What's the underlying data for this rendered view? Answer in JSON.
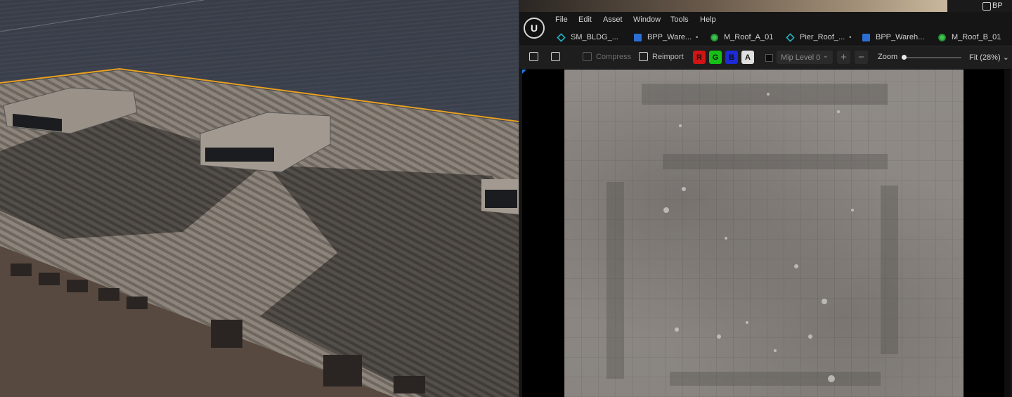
{
  "topbar": {
    "right_label": "BP"
  },
  "menu": [
    "File",
    "Edit",
    "Asset",
    "Window",
    "Tools",
    "Help"
  ],
  "tabs": [
    {
      "label": "SM_BLDG_...",
      "icon": "static-mesh-icon",
      "modified": false
    },
    {
      "label": "BPP_Ware...",
      "icon": "blueprint-icon",
      "modified": true
    },
    {
      "label": "M_Roof_A_01",
      "icon": "material-icon",
      "modified": false
    },
    {
      "label": "Pier_Roof_...",
      "icon": "static-mesh-icon",
      "modified": true
    },
    {
      "label": "BPP_Wareh...",
      "icon": "blueprint-icon",
      "modified": false
    },
    {
      "label": "M_Roof_B_01",
      "icon": "material-icon",
      "modified": false
    }
  ],
  "toolbar": {
    "compress_label": "Compress",
    "reimport_label": "Reimport",
    "channels": {
      "r": "R",
      "g": "G",
      "b": "B",
      "a": "A"
    },
    "channel_colors": {
      "r": "#d01414",
      "g": "#16c016",
      "b": "#1c2bd4",
      "a": "#e0e0e0"
    },
    "mip_level": "Mip Level 0",
    "plus": "+",
    "minus": "−",
    "zoom_label": "Zoom",
    "zoom_value": 0.02,
    "fit_label": "Fit (28%)"
  }
}
